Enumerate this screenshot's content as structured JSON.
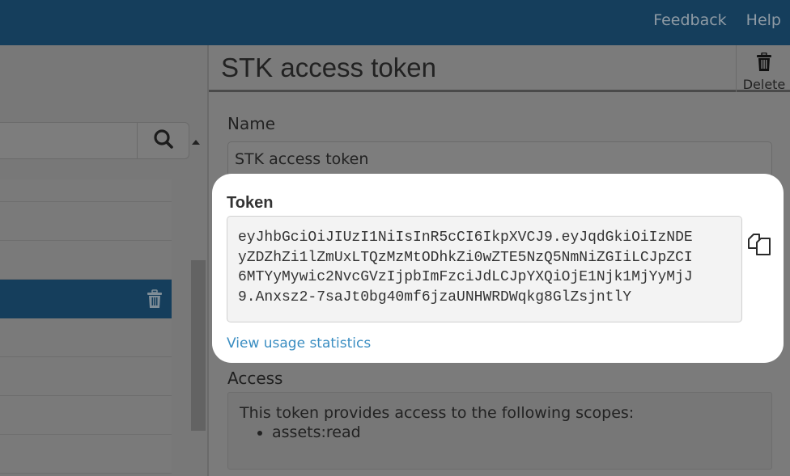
{
  "topbar": {
    "nav": [
      {
        "label": "Feedback"
      },
      {
        "label": "Help"
      }
    ]
  },
  "sidebar": {
    "search": {
      "placeholder": "",
      "value": ""
    },
    "search_icon": "search-icon",
    "selected_row_icon": "trash-icon"
  },
  "detail": {
    "title": "STK access token",
    "delete_label": "Delete",
    "name_label": "Name",
    "name_value": "STK access token",
    "token_label": "Token",
    "token_lines": [
      "eyJhbGciOiJIUzI1NiIsInR5cCI6IkpXVCJ9.eyJqdGkiOiIzNDE",
      "yZDZhZi1lZmUxLTQzMzMtODhkZi0wZTE5NzQ5NmNiZGIiLCJpZCI",
      "6MTYyMywic2NvcGVzIjpbImFzciJdLCJpYXQiOjE1Njk1MjYyMjJ",
      "9.Anxsz2-7saJt0bg40mf6jzaUNHWRDWqkg8GlZsjntlY"
    ],
    "copy_icon": "copy-icon",
    "usage_link": "View usage statistics",
    "access_label": "Access",
    "access_text": "This token provides access to the following scopes:",
    "scopes": [
      "assets:read"
    ]
  },
  "colors": {
    "brand": "#153e5c",
    "link": "#3b8ec2"
  }
}
